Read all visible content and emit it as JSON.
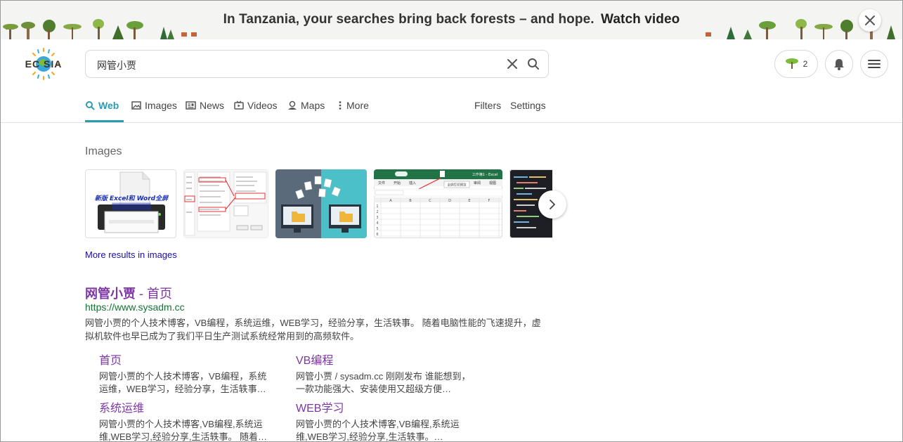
{
  "banner": {
    "text": "In Tanzania, your searches bring back forests – and hope.",
    "link": "Watch video",
    "close_icon": "close-icon"
  },
  "header": {
    "logo_text": "ECOSIA",
    "search_value": "网管小贾",
    "tree_count": "2"
  },
  "tabs": [
    {
      "label": "Web",
      "icon": "search-icon"
    },
    {
      "label": "Images",
      "icon": "image-icon"
    },
    {
      "label": "News",
      "icon": "news-icon"
    },
    {
      "label": "Videos",
      "icon": "video-icon"
    },
    {
      "label": "Maps",
      "icon": "map-pin-icon"
    },
    {
      "label": "More",
      "icon": "more-vertical-icon"
    }
  ],
  "tools": {
    "filters": "Filters",
    "settings": "Settings"
  },
  "images": {
    "heading": "Images",
    "thumb1_caption": "新版 Excel和 Word全屏",
    "thumb4_menu": [
      "文件",
      "开始",
      "插入",
      "审阅",
      "视图"
    ],
    "thumb4_title": "工作簿1 - Excel",
    "thumb4_tooltip": "全屏打印预览",
    "more_link": "More results in images"
  },
  "result": {
    "title_strong": "网管小贾",
    "title_rest": " - 首页",
    "url": "https://www.sysadm.cc",
    "snippet": "网管小贾的个人技术博客，VB编程，系统运维，WEB学习，经验分享，生活轶事。 随着电脑性能的飞速提升，虚拟机软件也早已成为了我们平日生产测试系统经常用到的高频软件。",
    "sitelinks": [
      {
        "title": "首页",
        "desc": "网管小贾的个人技术博客，VB编程，系统运维，WEB学习，经验分享，生活轶事…"
      },
      {
        "title": "VB编程",
        "desc": "网管小贾 / sysadm.cc 刚刚发布 谁能想到，一款功能强大、安装使用又超级方便…"
      },
      {
        "title": "系统运维",
        "desc": "网管小贾的个人技术博客,VB编程,系统运维,WEB学习,经验分享,生活轶事。 随着…"
      },
      {
        "title": "WEB学习",
        "desc": "网管小贾的个人技术博客,VB编程,系统运维,WEB学习,经验分享,生活轶事。…"
      }
    ]
  },
  "colors": {
    "accent": "#2b9bb0",
    "visited_link": "#7d36a5",
    "url_green": "#137333",
    "link_blue": "#1a0dab"
  }
}
